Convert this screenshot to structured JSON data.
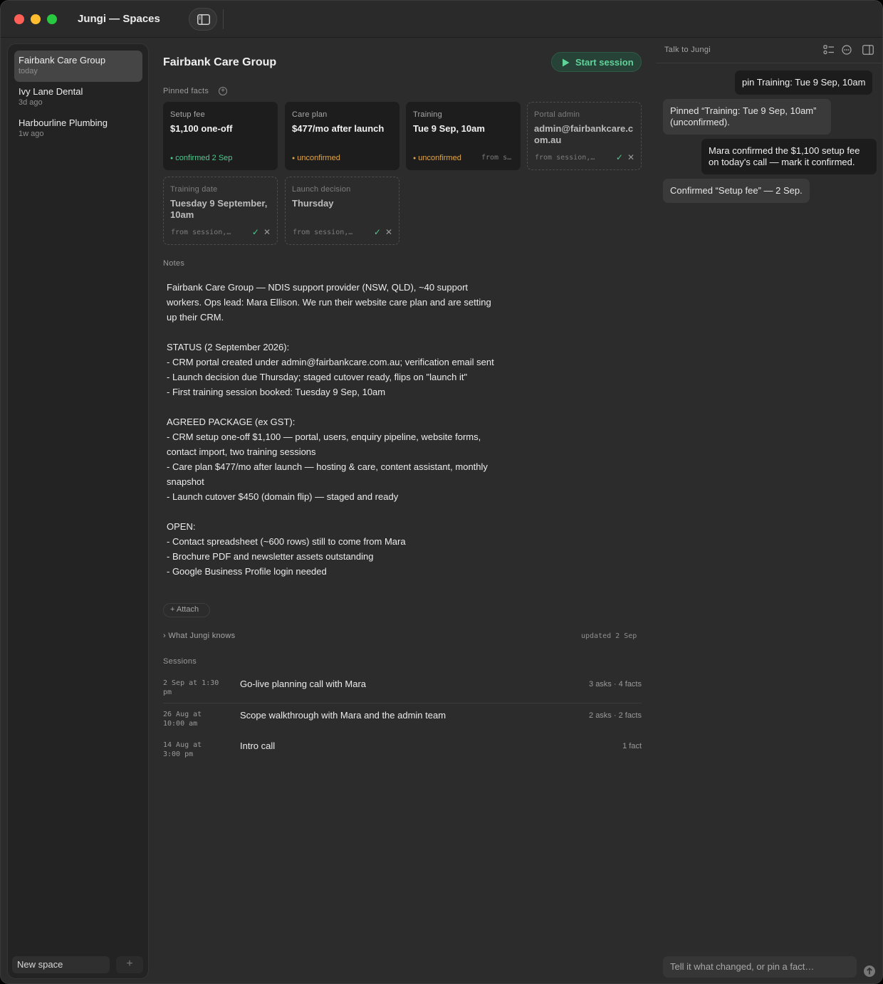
{
  "window": {
    "title": "Jungi — Spaces"
  },
  "sidebar": {
    "spaces": [
      {
        "name": "Fairbank Care Group",
        "ago": "today",
        "active": true
      },
      {
        "name": "Ivy Lane Dental",
        "ago": "3d ago",
        "active": false
      },
      {
        "name": "Harbourline Plumbing",
        "ago": "1w ago",
        "active": false
      }
    ],
    "new_space_placeholder": "New space",
    "new_space_add": "+"
  },
  "main": {
    "title": "Fairbank Care Group",
    "start_session_label": "Start session",
    "pinned_label": "Pinned facts",
    "pinned_add": "+",
    "facts": [
      {
        "label": "Setup fee",
        "value": "$1,100 one-off",
        "status": "confirmed 2 Sep",
        "state": "confirmed"
      },
      {
        "label": "Care plan",
        "value": "$477/mo after launch",
        "status": "unconfirmed",
        "state": "unconfirmed"
      },
      {
        "label": "Training",
        "value": "Tue 9 Sep, 10am",
        "status": "unconfirmed",
        "from": "from s…",
        "state": "unconfirmed"
      },
      {
        "label": "Portal admin",
        "value": "admin@fairbankcare.com.au",
        "from": "from session,…",
        "state": "pending"
      },
      {
        "label": "Training date",
        "value": "Tuesday 9 September, 10am",
        "from": "from session,…",
        "state": "pending"
      },
      {
        "label": "Launch decision",
        "value": "Thursday",
        "from": "from session,…",
        "state": "pending"
      }
    ],
    "accept_glyph": "✓",
    "reject_glyph": "✕",
    "status_dot": "●",
    "notes_label": "Notes",
    "notes": "Fairbank Care Group — NDIS support provider (NSW, QLD), ~40 support workers. Ops lead: Mara Ellison. We run their website care plan and are setting up their CRM.\n\nSTATUS (2 September 2026):\n- CRM portal created under admin@fairbankcare.com.au; verification email sent\n- Launch decision due Thursday; staged cutover ready, flips on \"launch it\"\n- First training session booked: Tuesday 9 Sep, 10am\n\nAGREED PACKAGE (ex GST):\n- CRM setup one-off $1,100 — portal, users, enquiry pipeline, website forms, contact import, two training sessions\n- Care plan $477/mo after launch — hosting & care, content assistant, monthly snapshot\n- Launch cutover $450 (domain flip) — staged and ready\n\nOPEN:\n- Contact spreadsheet (~600 rows) still to come from Mara\n- Brochure PDF and newsletter assets outstanding\n- Google Business Profile login needed",
    "attach_label": "+ Attach",
    "knows_label": "› What Jungi knows",
    "knows_updated": "updated 2 Sep",
    "sessions_label": "Sessions",
    "sessions": [
      {
        "date": "2 Sep at 1:30 pm",
        "title": "Go-live planning call with Mara",
        "meta": "3 asks · 4 facts"
      },
      {
        "date": "26 Aug at 10:00 am",
        "title": "Scope walkthrough with Mara and the admin team",
        "meta": "2 asks · 2 facts"
      },
      {
        "date": "14 Aug at 3:00 pm",
        "title": "Intro call",
        "meta": "1 fact"
      }
    ]
  },
  "chat": {
    "title": "Talk to Jungi",
    "icons": [
      "checklist-icon",
      "more-icon",
      "panel-icon"
    ],
    "messages": [
      {
        "role": "user",
        "text": "pin Training: Tue 9 Sep, 10am"
      },
      {
        "role": "assistant",
        "text": "Pinned “Training: Tue 9 Sep, 10am” (unconfirmed)."
      },
      {
        "role": "user",
        "text": "Mara confirmed the $1,100 setup fee on today's call — mark it confirmed."
      },
      {
        "role": "assistant",
        "text": "Confirmed “Setup fee” — 2 Sep."
      }
    ],
    "input_placeholder": "Tell it what changed, or pin a fact…"
  },
  "colors": {
    "background": "#2c2c2c",
    "sidebar": "#232323",
    "accent_green": "#5fd39a",
    "confirmed": "#4fc98e",
    "unconfirmed": "#e0a64e"
  }
}
